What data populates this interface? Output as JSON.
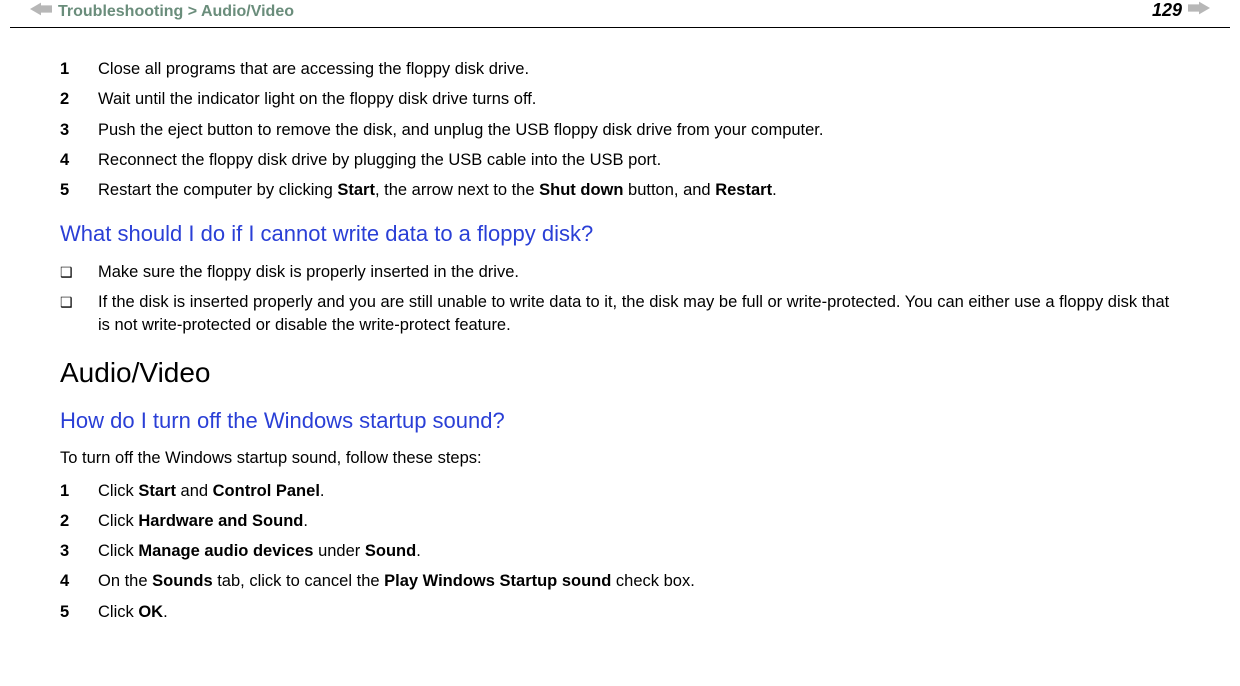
{
  "header": {
    "breadcrumb": "Troubleshooting > Audio/Video",
    "page_number": "129"
  },
  "steps_a": [
    {
      "n": "1",
      "segments": [
        {
          "t": "Close all programs that are accessing the floppy disk drive."
        }
      ]
    },
    {
      "n": "2",
      "segments": [
        {
          "t": "Wait until the indicator light on the floppy disk drive turns off."
        }
      ]
    },
    {
      "n": "3",
      "segments": [
        {
          "t": "Push the eject button to remove the disk, and unplug the USB floppy disk drive from your computer."
        }
      ]
    },
    {
      "n": "4",
      "segments": [
        {
          "t": "Reconnect the floppy disk drive by plugging the USB cable into the USB port."
        }
      ]
    },
    {
      "n": "5",
      "segments": [
        {
          "t": "Restart the computer by clicking "
        },
        {
          "t": "Start",
          "b": true
        },
        {
          "t": ", the arrow next to the "
        },
        {
          "t": "Shut down",
          "b": true
        },
        {
          "t": " button, and "
        },
        {
          "t": "Restart",
          "b": true
        },
        {
          "t": "."
        }
      ]
    }
  ],
  "q1": "What should I do if I cannot write data to a floppy disk?",
  "bullets_a": [
    {
      "segments": [
        {
          "t": "Make sure the floppy disk is properly inserted in the drive."
        }
      ]
    },
    {
      "segments": [
        {
          "t": "If the disk is inserted properly and you are still unable to write data to it, the disk may be full or write-protected. You can either use a floppy disk that is not write-protected or disable the write-protect feature."
        }
      ]
    }
  ],
  "section_title": "Audio/Video",
  "q2": "How do I turn off the Windows startup sound?",
  "q2_intro": "To turn off the Windows startup sound, follow these steps:",
  "steps_b": [
    {
      "n": "1",
      "segments": [
        {
          "t": "Click "
        },
        {
          "t": "Start",
          "b": true
        },
        {
          "t": " and "
        },
        {
          "t": "Control Panel",
          "b": true
        },
        {
          "t": "."
        }
      ]
    },
    {
      "n": "2",
      "segments": [
        {
          "t": "Click "
        },
        {
          "t": "Hardware and Sound",
          "b": true
        },
        {
          "t": "."
        }
      ]
    },
    {
      "n": "3",
      "segments": [
        {
          "t": "Click "
        },
        {
          "t": "Manage audio devices",
          "b": true
        },
        {
          "t": " under "
        },
        {
          "t": "Sound",
          "b": true
        },
        {
          "t": "."
        }
      ]
    },
    {
      "n": "4",
      "segments": [
        {
          "t": "On the "
        },
        {
          "t": "Sounds",
          "b": true
        },
        {
          "t": " tab, click to cancel the "
        },
        {
          "t": "Play Windows Startup sound",
          "b": true
        },
        {
          "t": " check box."
        }
      ]
    },
    {
      "n": "5",
      "segments": [
        {
          "t": "Click "
        },
        {
          "t": "OK",
          "b": true
        },
        {
          "t": "."
        }
      ]
    }
  ]
}
